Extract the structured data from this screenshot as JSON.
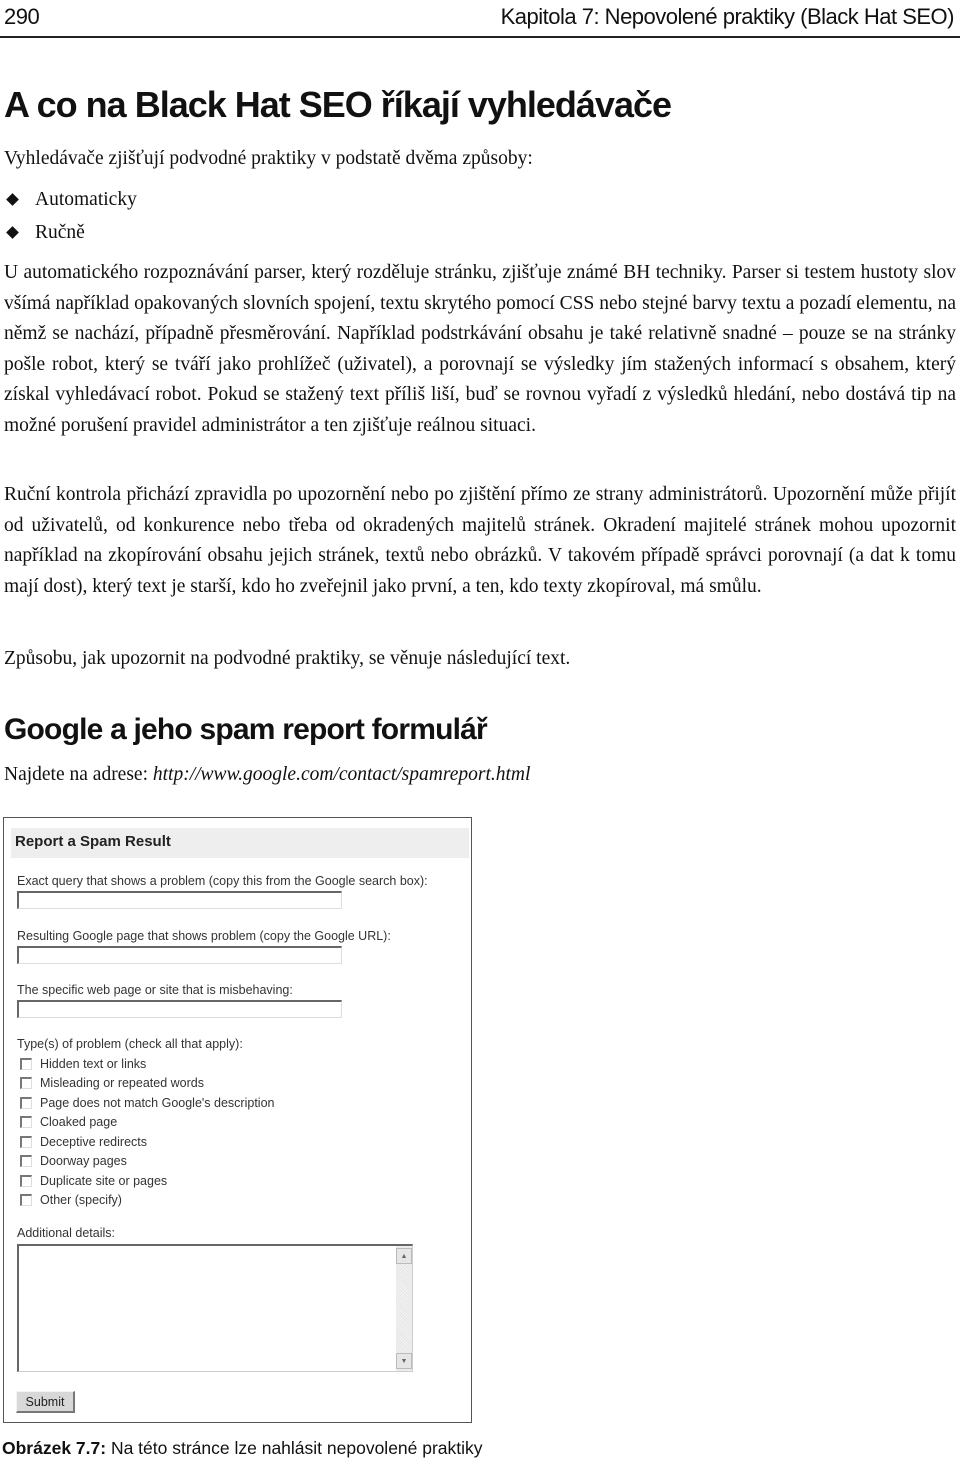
{
  "header": {
    "page_number": "290",
    "chapter_title": "Kapitola 7: Nepovolené praktiky (Black Hat SEO)"
  },
  "section1": {
    "title": "A co na Black Hat SEO říkají vyhledávače",
    "intro": "Vyhledávače zjišťují podvodné praktiky v podstatě dvěma způsoby:",
    "bullets": [
      "Automaticky",
      "Ručně"
    ],
    "paragraphs": [
      "U automatického rozpoznávání parser, který rozděluje stránku, zjišťuje známé BH techniky. Parser si testem hustoty slov všímá například opakovaných slovních spojení, textu skrytého pomocí CSS nebo stejné barvy textu a pozadí elementu, na němž se nachází, případně přesměrování. Například podstrkávání obsahu je také relativně snadné – pouze se na stránky pošle robot, který se tváří jako prohlížeč (uživatel), a porovnají se výsledky jím stažených informací s obsahem, který získal vyhle­dávací robot. Pokud se stažený text příliš liší, buď se rovnou vyřadí z výsledků hledání, nebo dostává tip na možné porušení pravidel administrátor a ten zjišťuje reálnou situaci.",
      "Ruční kontrola přichází zpravidla po upozornění nebo po zjištění přímo ze strany administrátorů. Upozornění může přijít od uživatelů, od konkurence nebo třeba od okradených majitelů stránek. Okradení majitelé stránek mohou upozornit například na zkopírování obsahu jejich stránek, textů nebo obrázků. V takovém případě správci porovnají (a dat k tomu mají dost), který text je starší, kdo ho zveřejnil jako první, a ten, kdo texty zkopíroval, má smůlu.",
      "Způsobu, jak upozornit na podvodné praktiky, se věnuje následující text."
    ]
  },
  "section2": {
    "title": "Google a jeho spam report formulář",
    "address_label": "Najdete na adrese: ",
    "address_url": "http://www.google.com/contact/spamreport.html"
  },
  "form": {
    "title": "Report a Spam Result",
    "fields": [
      {
        "label": "Exact query that shows a problem (copy this from the Google search box):",
        "value": ""
      },
      {
        "label": "Resulting Google page that shows problem (copy the Google URL):",
        "value": ""
      },
      {
        "label": "The specific web page or site that is misbehaving:",
        "value": ""
      }
    ],
    "types_label": "Type(s) of problem (check all that apply):",
    "checkboxes": [
      {
        "label": "Hidden text or links",
        "checked": false
      },
      {
        "label": "Misleading or repeated words",
        "checked": false
      },
      {
        "label": "Page does not match Google's description",
        "checked": false
      },
      {
        "label": "Cloaked page",
        "checked": false
      },
      {
        "label": "Deceptive redirects",
        "checked": false
      },
      {
        "label": "Doorway pages",
        "checked": false
      },
      {
        "label": "Duplicate site or pages",
        "checked": false
      },
      {
        "label": "Other (specify)",
        "checked": false
      }
    ],
    "details_label": "Additional details:",
    "details_value": "",
    "submit_label": "Submit",
    "scroll_up_icon": "▲",
    "scroll_down_icon": "▼"
  },
  "caption": {
    "label": "Obrázek 7.7:",
    "text": " Na této stránce lze nahlásit nepovolené praktiky"
  }
}
